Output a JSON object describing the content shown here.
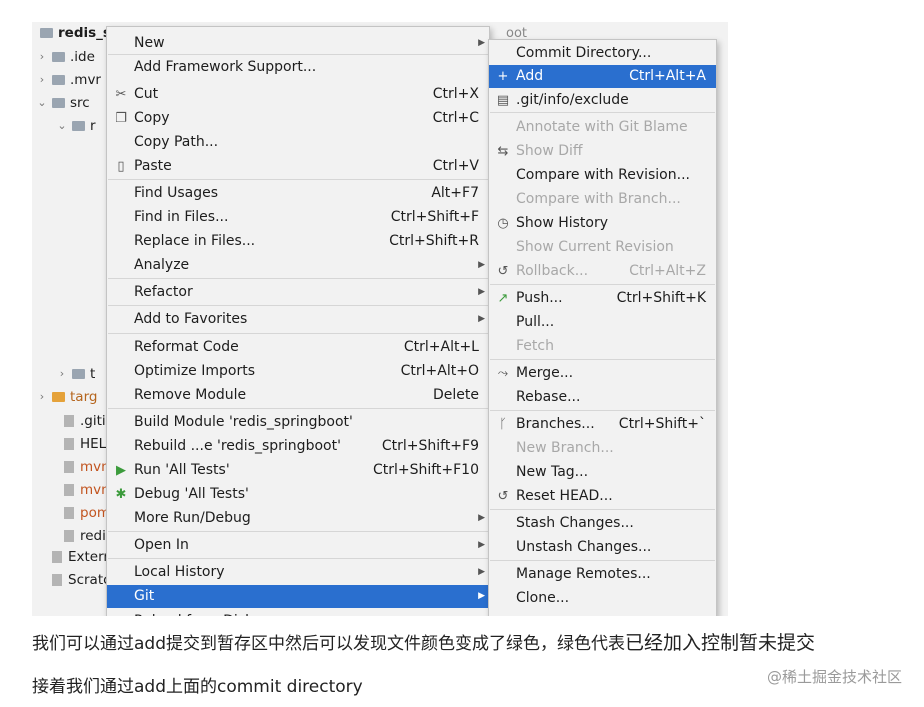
{
  "project_tree": {
    "root_label": "redis_s",
    "header_obscured": "oot",
    "rows": [
      {
        "label": ".ide",
        "expander": "›",
        "kind": "folder"
      },
      {
        "label": ".mvr",
        "expander": "›",
        "kind": "folder"
      },
      {
        "label": "src",
        "expander": "⌄",
        "kind": "folder"
      },
      {
        "label": "r",
        "expander": "⌄",
        "kind": "folder"
      },
      {
        "label": "targ",
        "expander": "›",
        "kind": "folder-orange"
      },
      {
        "label": ".gitig",
        "expander": "",
        "kind": "file"
      },
      {
        "label": "HEL",
        "expander": "",
        "kind": "file"
      },
      {
        "label": "mvn",
        "expander": "",
        "kind": "file"
      },
      {
        "label": "mvn",
        "expander": "",
        "kind": "file"
      },
      {
        "label": "pom",
        "expander": "",
        "kind": "file"
      },
      {
        "label": "redi",
        "expander": "",
        "kind": "file"
      },
      {
        "label": "Externa",
        "expander": "",
        "kind": "lib"
      },
      {
        "label": "Scratch",
        "expander": "",
        "kind": "scratch"
      }
    ],
    "small_rows": [
      {
        "label": "t",
        "expander": "›"
      }
    ]
  },
  "context_menu": {
    "items": [
      {
        "label": "New",
        "shortcut": "",
        "submenu": true,
        "icon": ""
      },
      {
        "label": "Add Framework Support...",
        "shortcut": "",
        "submenu": false,
        "icon": ""
      },
      {
        "label": "Cut",
        "shortcut": "Ctrl+X",
        "submenu": false,
        "icon": "scissors-icon"
      },
      {
        "label": "Copy",
        "shortcut": "Ctrl+C",
        "submenu": false,
        "icon": "copy-icon"
      },
      {
        "label": "Copy Path...",
        "shortcut": "",
        "submenu": false,
        "icon": ""
      },
      {
        "label": "Paste",
        "shortcut": "Ctrl+V",
        "submenu": false,
        "icon": "paste-icon"
      },
      {
        "label": "Find Usages",
        "shortcut": "Alt+F7",
        "submenu": false,
        "icon": ""
      },
      {
        "label": "Find in Files...",
        "shortcut": "Ctrl+Shift+F",
        "submenu": false,
        "icon": ""
      },
      {
        "label": "Replace in Files...",
        "shortcut": "Ctrl+Shift+R",
        "submenu": false,
        "icon": ""
      },
      {
        "label": "Analyze",
        "shortcut": "",
        "submenu": true,
        "icon": ""
      },
      {
        "label": "Refactor",
        "shortcut": "",
        "submenu": true,
        "icon": ""
      },
      {
        "label": "Add to Favorites",
        "shortcut": "",
        "submenu": true,
        "icon": ""
      },
      {
        "label": "Reformat Code",
        "shortcut": "Ctrl+Alt+L",
        "submenu": false,
        "icon": ""
      },
      {
        "label": "Optimize Imports",
        "shortcut": "Ctrl+Alt+O",
        "submenu": false,
        "icon": ""
      },
      {
        "label": "Remove Module",
        "shortcut": "Delete",
        "submenu": false,
        "icon": ""
      },
      {
        "label": "Build Module 'redis_springboot'",
        "shortcut": "",
        "submenu": false,
        "icon": ""
      },
      {
        "label": "Rebuild ...e 'redis_springboot'",
        "shortcut": "Ctrl+Shift+F9",
        "submenu": false,
        "icon": ""
      },
      {
        "label": "Run 'All Tests'",
        "shortcut": "Ctrl+Shift+F10",
        "submenu": false,
        "icon": "run-icon"
      },
      {
        "label": "Debug 'All Tests'",
        "shortcut": "",
        "submenu": false,
        "icon": "debug-icon"
      },
      {
        "label": "More Run/Debug",
        "shortcut": "",
        "submenu": true,
        "icon": ""
      },
      {
        "label": "Open In",
        "shortcut": "",
        "submenu": true,
        "icon": ""
      },
      {
        "label": "Local History",
        "shortcut": "",
        "submenu": true,
        "icon": ""
      },
      {
        "label": "Git",
        "shortcut": "",
        "submenu": true,
        "icon": "",
        "selected": true
      }
    ],
    "partial_bottom_label": "Reload from Disk"
  },
  "git_submenu": {
    "items": [
      {
        "label": "Commit Directory...",
        "shortcut": "",
        "icon": "",
        "disabled": false
      },
      {
        "label": "Add",
        "shortcut": "Ctrl+Alt+A",
        "icon": "plus-icon",
        "disabled": false,
        "selected": true
      },
      {
        "label": ".git/info/exclude",
        "shortcut": "",
        "icon": "git-file-icon",
        "disabled": false
      },
      {
        "label": "Annotate with Git Blame",
        "shortcut": "",
        "icon": "",
        "disabled": true
      },
      {
        "label": "Show Diff",
        "shortcut": "",
        "icon": "diff-icon",
        "disabled": true
      },
      {
        "label": "Compare with Revision...",
        "shortcut": "",
        "icon": "",
        "disabled": false
      },
      {
        "label": "Compare with Branch...",
        "shortcut": "",
        "icon": "",
        "disabled": true
      },
      {
        "label": "Show History",
        "shortcut": "",
        "icon": "history-icon",
        "disabled": false
      },
      {
        "label": "Show Current Revision",
        "shortcut": "",
        "icon": "",
        "disabled": true
      },
      {
        "label": "Rollback...",
        "shortcut": "Ctrl+Alt+Z",
        "icon": "rollback-icon",
        "disabled": true
      },
      {
        "label": "Push...",
        "shortcut": "Ctrl+Shift+K",
        "icon": "push-icon",
        "disabled": false
      },
      {
        "label": "Pull...",
        "shortcut": "",
        "icon": "",
        "disabled": false
      },
      {
        "label": "Fetch",
        "shortcut": "",
        "icon": "",
        "disabled": true
      },
      {
        "label": "Merge...",
        "shortcut": "",
        "icon": "merge-icon",
        "disabled": false
      },
      {
        "label": "Rebase...",
        "shortcut": "",
        "icon": "",
        "disabled": false
      },
      {
        "label": "Branches...",
        "shortcut": "Ctrl+Shift+`",
        "icon": "branch-icon",
        "disabled": false
      },
      {
        "label": "New Branch...",
        "shortcut": "",
        "icon": "",
        "disabled": true
      },
      {
        "label": "New Tag...",
        "shortcut": "",
        "icon": "",
        "disabled": false
      },
      {
        "label": "Reset HEAD...",
        "shortcut": "",
        "icon": "reset-icon",
        "disabled": false
      },
      {
        "label": "Stash Changes...",
        "shortcut": "",
        "icon": "",
        "disabled": false
      },
      {
        "label": "Unstash Changes...",
        "shortcut": "",
        "icon": "",
        "disabled": false
      },
      {
        "label": "Manage Remotes...",
        "shortcut": "",
        "icon": "",
        "disabled": false
      },
      {
        "label": "Clone...",
        "shortcut": "",
        "icon": "",
        "disabled": false
      }
    ]
  },
  "caption": {
    "line1_a": "我们可以通过add提交到暂存区中然后可以发现文件颜色变成了绿色，绿色代表",
    "line1_b": "已经加入控制暂未提交",
    "line2": "接着我们通过add上面的commit directory",
    "watermark": "@稀土掘金技术社区"
  },
  "colors": {
    "selection": "#2a6fcf",
    "menu_bg": "#f2f2f2",
    "disabled_text": "#a8a8a8"
  }
}
